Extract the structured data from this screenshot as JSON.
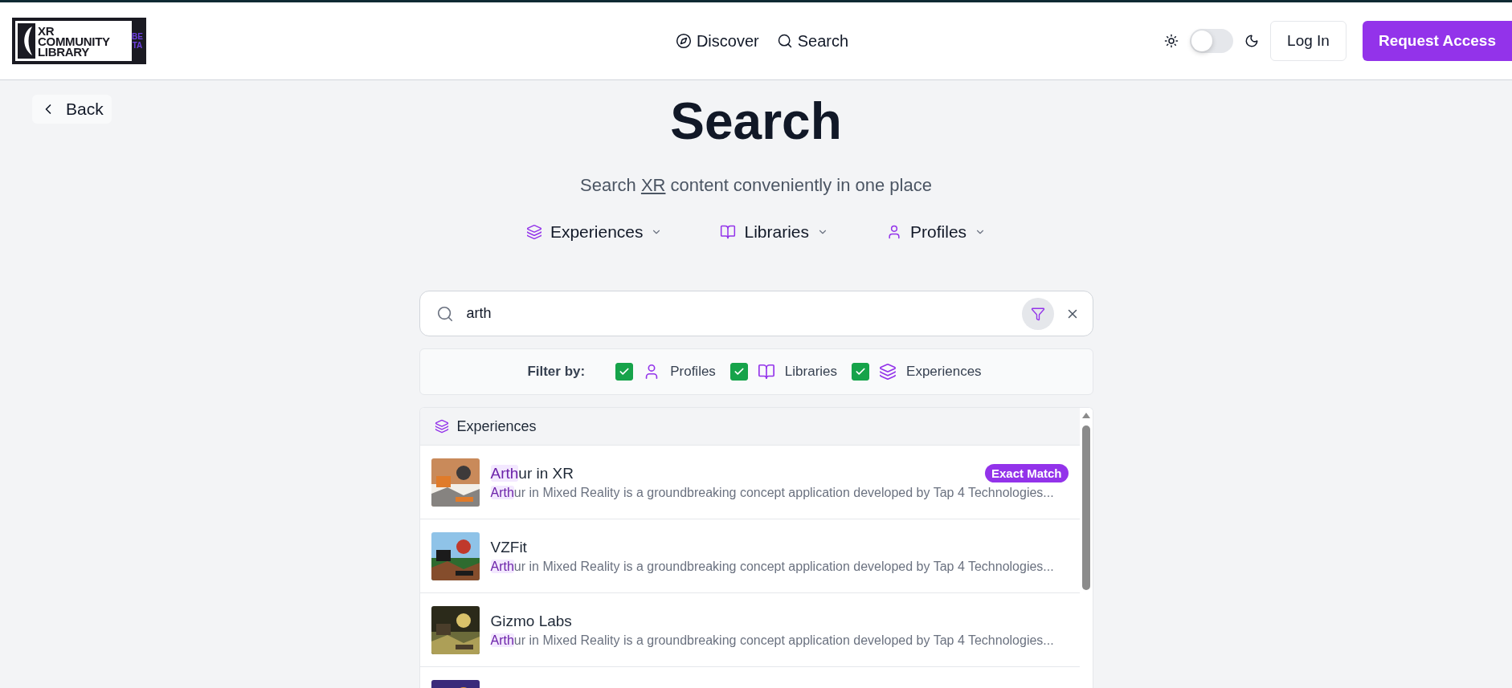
{
  "header": {
    "logo": {
      "lines": [
        "XR",
        "COMMUNITY",
        "LIBRARY"
      ],
      "badge": "BETA"
    },
    "nav": [
      {
        "label": "Discover"
      },
      {
        "label": "Search"
      }
    ],
    "theme_toggle": {
      "on": false
    },
    "login": "Log In",
    "request_access": "Request Access"
  },
  "back": "Back",
  "title": "Search",
  "subtitle": {
    "before": "Search ",
    "underlined": "XR",
    "after": " content conveniently in one place"
  },
  "categories": [
    {
      "label": "Experiences"
    },
    {
      "label": "Libraries"
    },
    {
      "label": "Profiles"
    }
  ],
  "search": {
    "value": "arth",
    "filter_active": true
  },
  "filter": {
    "label": "Filter by:",
    "options": [
      {
        "label": "Profiles",
        "checked": true
      },
      {
        "label": "Libraries",
        "checked": true
      },
      {
        "label": "Experiences",
        "checked": true
      }
    ]
  },
  "results": {
    "section": "Experiences",
    "items": [
      {
        "kind": "result",
        "title_match": "Arth",
        "title_rest": "ur in XR",
        "desc_match": "Arth",
        "desc_rest": "ur in Mixed Reality is a groundbreaking concept application developed by Tap 4 Technologies...",
        "badge": "Exact Match"
      },
      {
        "kind": "result",
        "title_rest": "VZFit",
        "desc_match": "Arth",
        "desc_rest": "ur in Mixed Reality is a groundbreaking concept application developed by Tap 4 Technologies..."
      },
      {
        "kind": "result",
        "title_rest": "Gizmo Labs",
        "desc_match": "Arth",
        "desc_rest": "ur in Mixed Reality is a groundbreaking concept application developed by Tap 4 Technologies..."
      },
      {
        "kind": "partial"
      }
    ]
  }
}
